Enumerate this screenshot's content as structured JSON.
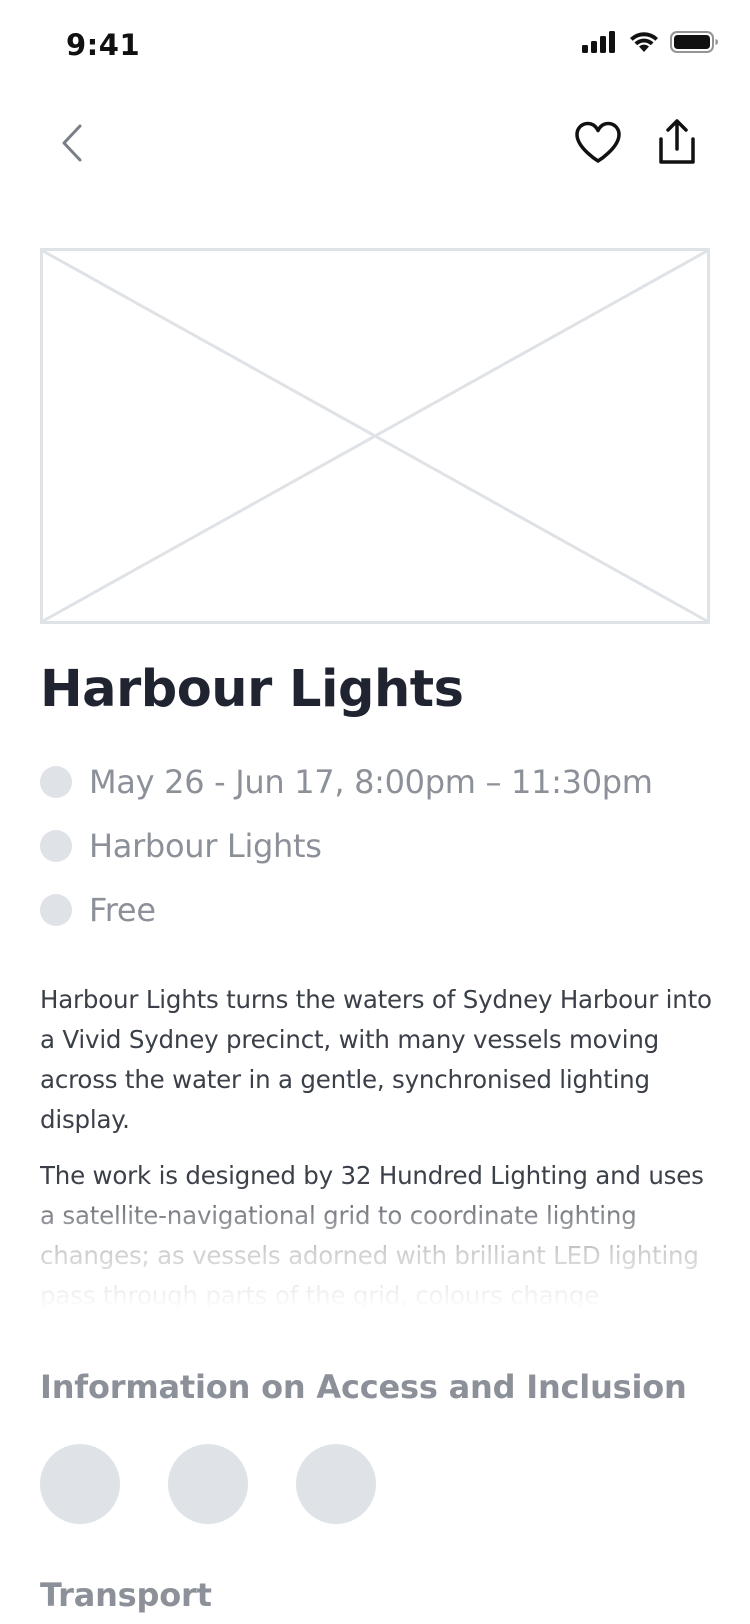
{
  "status_bar": {
    "time": "9:41"
  },
  "nav": {
    "back_icon": "chevron-left-icon",
    "favorite_icon": "heart-icon",
    "share_icon": "share-icon"
  },
  "hero": {
    "image_icon": "image-placeholder-icon"
  },
  "event": {
    "title": "Harbour Lights",
    "details": [
      {
        "icon": "dot-icon",
        "text": "May 26 - Jun 17, 8:00pm – 11:30pm"
      },
      {
        "icon": "dot-icon",
        "text": "Harbour Lights"
      },
      {
        "icon": "dot-icon",
        "text": "Free"
      }
    ],
    "description": [
      "Harbour Lights turns the waters of Sydney Harbour into a Vivid Sydney precinct, with many vessels moving across the water in a gentle, synchronised lighting display.",
      "The work is designed by 32 Hundred Lighting and uses a satellite-navigational grid to coordinate lighting changes; as vessels adorned with brilliant LED lighting pass through parts of the grid, colours change"
    ]
  },
  "access": {
    "title": "Information on Access and Inclusion",
    "icons": [
      "access-icon",
      "access-icon",
      "access-icon"
    ]
  },
  "transport": {
    "title": "Transport"
  },
  "colors": {
    "title_text": "#1f2430",
    "muted_text": "#8c9199",
    "body_text": "#3a3f48",
    "placeholder": "#dfe2e6"
  }
}
